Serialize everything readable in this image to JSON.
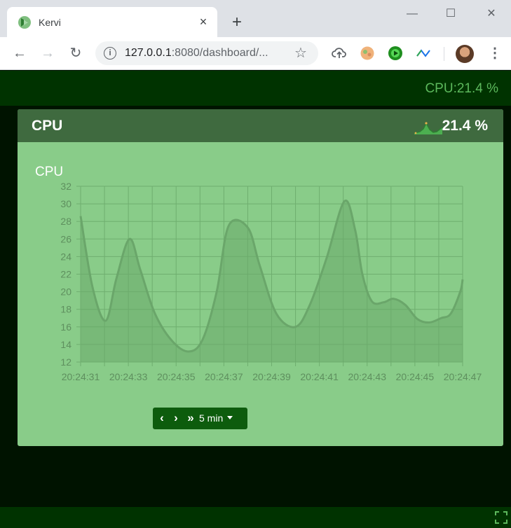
{
  "browser": {
    "tab_title": "Kervi",
    "tab_close": "×",
    "new_tab": "+",
    "url_host": "127.0.0.1",
    "url_rest": ":8080/dashboard/...",
    "window_minimize": "—",
    "window_maximize": "☐",
    "window_close": "✕",
    "back_icon": "←",
    "forward_icon": "→",
    "reload_icon": "↻",
    "bookmark_icon": "☆",
    "menu_icon": "⋮",
    "extensions": [
      "cloud-upload-icon",
      "extension-orange-icon",
      "extension-green-circle-icon",
      "extension-pulse-icon"
    ]
  },
  "app": {
    "header_status": "CPU:21.4 %",
    "accent_color": "#5cb85c",
    "panel": {
      "title": "CPU",
      "value": "21.4 %",
      "chart_label": "CPU"
    },
    "controls": {
      "prev": "‹",
      "next": "›",
      "latest": "»",
      "range": "5 min"
    }
  },
  "chart_data": {
    "type": "area",
    "title": "CPU",
    "xlabel": "",
    "ylabel": "",
    "ylim": [
      12,
      32
    ],
    "yticks": [
      12,
      14,
      16,
      18,
      20,
      22,
      24,
      26,
      28,
      30,
      32
    ],
    "xticks": [
      "20:24:31",
      "20:24:33",
      "20:24:35",
      "20:24:37",
      "20:24:39",
      "20:24:41",
      "20:24:43",
      "20:24:45",
      "20:24:47"
    ],
    "grid": true,
    "series": [
      {
        "name": "CPU",
        "points": [
          [
            0,
            28.6
          ],
          [
            0.5,
            20.5
          ],
          [
            1.05,
            16.7
          ],
          [
            1.5,
            21.5
          ],
          [
            2.05,
            26.0
          ],
          [
            2.5,
            22.5
          ],
          [
            3.1,
            17.6
          ],
          [
            3.8,
            14.5
          ],
          [
            4.5,
            13.2
          ],
          [
            5.1,
            14.5
          ],
          [
            5.7,
            20.0
          ],
          [
            6.2,
            27.5
          ],
          [
            7.0,
            27.3
          ],
          [
            7.5,
            23.0
          ],
          [
            8.2,
            17.5
          ],
          [
            9.0,
            16.0
          ],
          [
            9.6,
            18.5
          ],
          [
            10.3,
            23.8
          ],
          [
            11.05,
            30.3
          ],
          [
            11.5,
            27.0
          ],
          [
            11.8,
            22.0
          ],
          [
            12.2,
            18.9
          ],
          [
            12.7,
            18.8
          ],
          [
            13.1,
            19.2
          ],
          [
            13.6,
            18.5
          ],
          [
            14.1,
            16.9
          ],
          [
            14.6,
            16.5
          ],
          [
            15.1,
            17.0
          ],
          [
            15.5,
            17.5
          ],
          [
            15.9,
            20.0
          ],
          [
            16.0,
            21.4
          ]
        ]
      }
    ]
  }
}
